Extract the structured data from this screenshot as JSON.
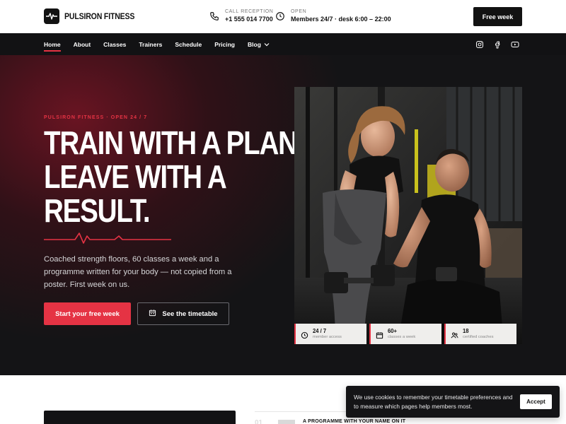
{
  "brand": {
    "name": "PULSIRON FITNESS",
    "accent": "#e53344",
    "dark": "#121214"
  },
  "header": {
    "reception_label": "CALL RECEPTION",
    "reception_value": "+1 555 014 7700",
    "open_label": "OPEN",
    "open_value": "Members 24/7 · desk 6:00 – 22:00",
    "cta_label": "Free week"
  },
  "nav": {
    "items": [
      {
        "label": "Home",
        "active": true
      },
      {
        "label": "About"
      },
      {
        "label": "Classes"
      },
      {
        "label": "Trainers"
      },
      {
        "label": "Schedule"
      },
      {
        "label": "Pricing"
      },
      {
        "label": "Blog",
        "dropdown": true
      }
    ],
    "social": [
      "instagram-icon",
      "facebook-icon",
      "youtube-icon"
    ]
  },
  "hero": {
    "eyebrow": "PULSIRON FITNESS · OPEN 24 / 7",
    "headline": [
      "TRAIN WITH A PLAN.",
      "LEAVE WITH A",
      "RESULT."
    ],
    "lede": "Coached strength floors, 60 classes a week and a programme written for your body — not copied from a poster. First week on us.",
    "primary_cta": "Start your free week",
    "secondary_cta": "See the timetable",
    "image_alt": "Trainer coaching a woman performing a dumbbell row",
    "stats": [
      {
        "icon": "clock-icon",
        "value": "24 / 7",
        "label": "member access"
      },
      {
        "icon": "calendar-icon",
        "value": "60+",
        "label": "classes a week"
      },
      {
        "icon": "coaches-icon",
        "value": "18",
        "label": "certified coaches"
      }
    ]
  },
  "section": {
    "row_number": "01",
    "row_title": "A PROGRAMME WITH YOUR NAME ON IT"
  },
  "cookie": {
    "text": "We use cookies to remember your timetable preferences and to measure which pages help members most.",
    "accept_label": "Accept"
  }
}
